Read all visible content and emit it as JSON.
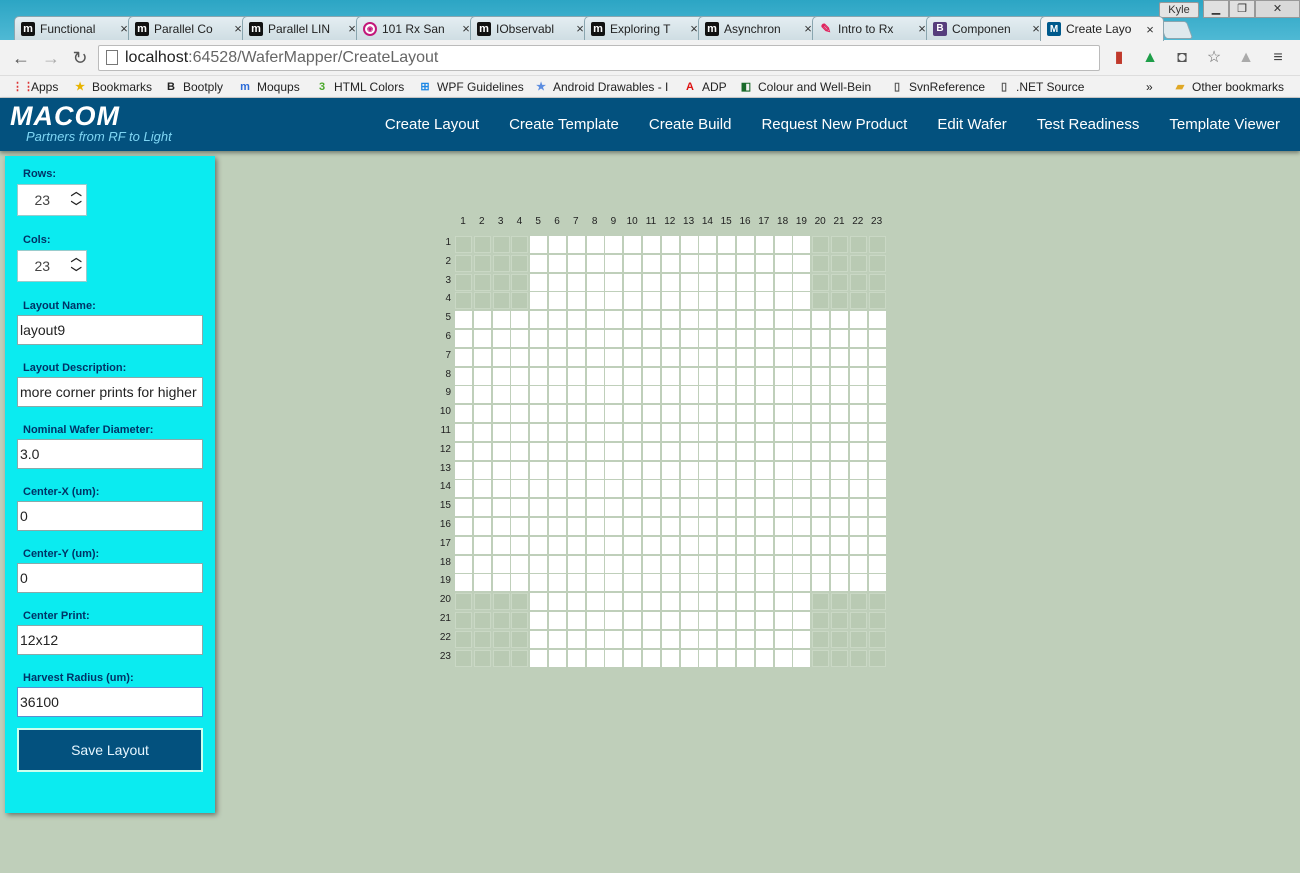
{
  "browser": {
    "tabs": [
      {
        "title": "Functional",
        "icon": "m-icon",
        "favclass": "fav-m",
        "glyph": "m"
      },
      {
        "title": "Parallel Co",
        "icon": "m-icon",
        "favclass": "fav-m",
        "glyph": "m"
      },
      {
        "title": "Parallel LIN",
        "icon": "m-icon",
        "favclass": "fav-m",
        "glyph": "m"
      },
      {
        "title": "101 Rx San",
        "icon": "rx-icon",
        "favclass": "fav-rx",
        "glyph": "◉"
      },
      {
        "title": "IObservabl",
        "icon": "m-icon",
        "favclass": "fav-m",
        "glyph": "m"
      },
      {
        "title": "Exploring T",
        "icon": "m-icon",
        "favclass": "fav-m",
        "glyph": "m"
      },
      {
        "title": "Asynchron",
        "icon": "m-icon",
        "favclass": "fav-m",
        "glyph": "m"
      },
      {
        "title": "Intro to Rx",
        "icon": "pin-icon",
        "favclass": "fav-pin",
        "glyph": "✎"
      },
      {
        "title": "Componen",
        "icon": "bootstrap-icon",
        "favclass": "fav-b",
        "glyph": "B"
      },
      {
        "title": "Create Layo",
        "icon": "macom-icon",
        "favclass": "fav-mac",
        "glyph": "M"
      }
    ],
    "active_tab": 9,
    "user": "Kyle",
    "url_host": "localhost",
    "url_path": ":64528/WaferMapper/CreateLayout",
    "bookmarks": [
      {
        "label": "Apps",
        "icon": "apps-grid-icon",
        "glyph": "⋮⋮",
        "color": "#d33"
      },
      {
        "label": "Bookmarks",
        "icon": "star-icon",
        "glyph": "★",
        "color": "#e8b400"
      },
      {
        "label": "Bootply",
        "icon": "bootply-icon",
        "glyph": "B",
        "color": "#222"
      },
      {
        "label": "Moqups",
        "icon": "moqups-icon",
        "glyph": "m",
        "color": "#2a6ad8"
      },
      {
        "label": "HTML Colors",
        "icon": "html-colors-icon",
        "glyph": "3",
        "color": "#4aa82a"
      },
      {
        "label": "WPF Guidelines",
        "icon": "windows-icon",
        "glyph": "⊞",
        "color": "#1e88e5"
      },
      {
        "label": "Android Drawables - I",
        "icon": "star-icon",
        "glyph": "★",
        "color": "#5c8de0"
      },
      {
        "label": "ADP",
        "icon": "adp-icon",
        "glyph": "A",
        "color": "#d11"
      },
      {
        "label": "Colour and Well-Bein",
        "icon": "colour-icon",
        "glyph": "◧",
        "color": "#1a6a2a"
      },
      {
        "label": "SvnReference",
        "icon": "page-icon",
        "glyph": "▯",
        "color": "#555"
      },
      {
        "label": ".NET Source",
        "icon": "page-icon",
        "glyph": "▯",
        "color": "#555"
      }
    ],
    "more_bookmarks": "»",
    "other_bookmarks": "Other bookmarks"
  },
  "header": {
    "brand": "MACOM",
    "tagline": "Partners from RF to Light",
    "nav": [
      "Create Layout",
      "Create Template",
      "Create Build",
      "Request New Product",
      "Edit Wafer",
      "Test Readiness",
      "Template Viewer"
    ]
  },
  "form": {
    "rows_label": "Rows:",
    "rows_value": "23",
    "cols_label": "Cols:",
    "cols_value": "23",
    "layout_name_label": "Layout Name:",
    "layout_name": "layout9",
    "layout_desc_label": "Layout Description:",
    "layout_desc": "more corner prints for higher",
    "diameter_label": "Nominal Wafer Diameter:",
    "diameter": "3.0",
    "center_x_label": "Center-X (um):",
    "center_x": "0",
    "center_y_label": "Center-Y (um):",
    "center_y": "0",
    "center_print_label": "Center Print:",
    "center_print": "12x12",
    "harvest_label": "Harvest Radius (um):",
    "harvest": "36100",
    "save_label": "Save Layout"
  },
  "wafer_grid": {
    "rows": 23,
    "cols": 23,
    "active_rows": [
      [
        5,
        19
      ],
      [
        5,
        19
      ],
      [
        5,
        19
      ],
      [
        5,
        19
      ],
      [
        1,
        23
      ],
      [
        1,
        23
      ],
      [
        1,
        23
      ],
      [
        1,
        23
      ],
      [
        1,
        23
      ],
      [
        1,
        23
      ],
      [
        1,
        23
      ],
      [
        1,
        23
      ],
      [
        1,
        23
      ],
      [
        1,
        23
      ],
      [
        1,
        23
      ],
      [
        1,
        23
      ],
      [
        1,
        23
      ],
      [
        1,
        23
      ],
      [
        1,
        23
      ],
      [
        5,
        19
      ],
      [
        5,
        19
      ],
      [
        5,
        19
      ],
      [
        5,
        19
      ]
    ]
  }
}
